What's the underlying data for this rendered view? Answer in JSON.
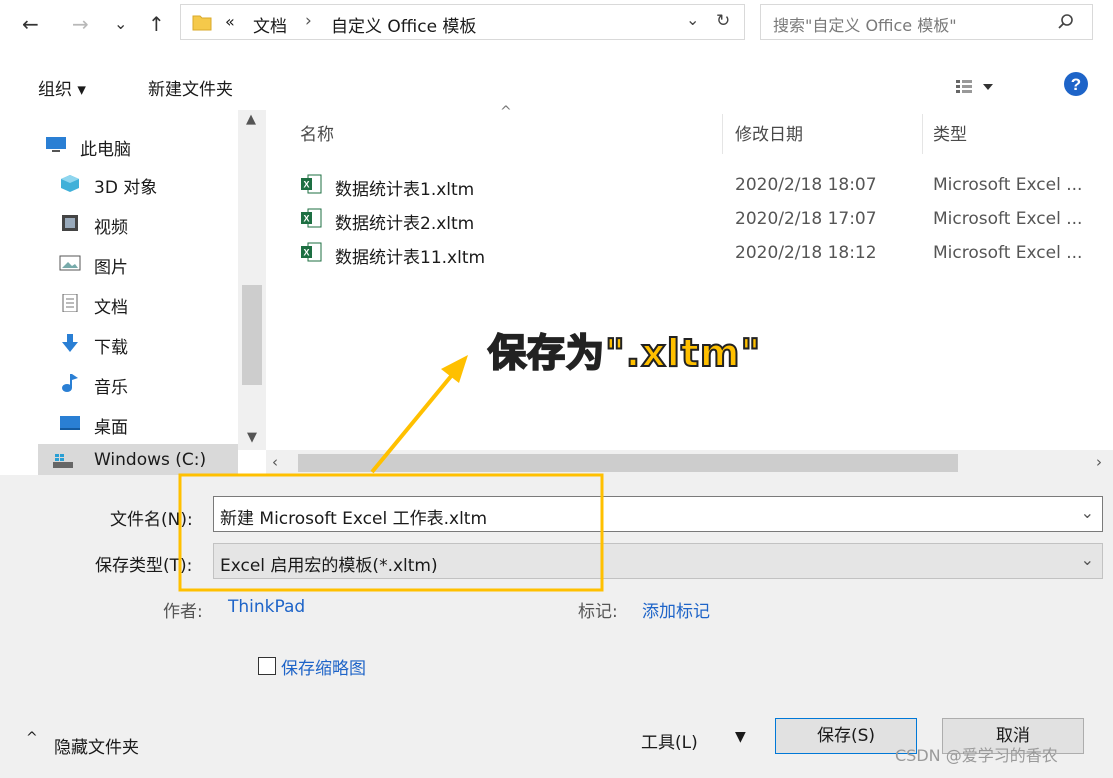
{
  "nav": {
    "back": "←",
    "forward": "→",
    "recent": "⌄",
    "up": "↑"
  },
  "address": {
    "overflow": "«",
    "crumb1": "文档",
    "sep": "›",
    "crumb2": "自定义 Office 模板",
    "dropdown": "⌄",
    "refresh": "↻"
  },
  "search": {
    "placeholder": "搜索\"自定义 Office 模板\""
  },
  "toolbar": {
    "organize": "组织 ▾",
    "new_folder": "新建文件夹"
  },
  "sidebar": {
    "items": [
      {
        "label": "此电脑",
        "icon": "computer-icon"
      },
      {
        "label": "3D 对象",
        "icon": "cube-icon"
      },
      {
        "label": "视频",
        "icon": "video-icon"
      },
      {
        "label": "图片",
        "icon": "picture-icon"
      },
      {
        "label": "文档",
        "icon": "document-icon"
      },
      {
        "label": "下载",
        "icon": "download-icon"
      },
      {
        "label": "音乐",
        "icon": "music-icon"
      },
      {
        "label": "桌面",
        "icon": "desktop-icon"
      },
      {
        "label": "Windows (C:)",
        "icon": "drive-icon"
      }
    ]
  },
  "columns": {
    "name": "名称",
    "date": "修改日期",
    "type": "类型"
  },
  "files": [
    {
      "name": "数据统计表1.xltm",
      "date": "2020/2/18 18:07",
      "type": "Microsoft Excel ..."
    },
    {
      "name": "数据统计表2.xltm",
      "date": "2020/2/18 17:07",
      "type": "Microsoft Excel ..."
    },
    {
      "name": "数据统计表11.xltm",
      "date": "2020/2/18 18:12",
      "type": "Microsoft Excel ..."
    }
  ],
  "annotation": {
    "text": "保存为\".xltm\"",
    "color": "#ffc000"
  },
  "form": {
    "filename_label": "文件名(N):",
    "filename_value": "新建 Microsoft Excel 工作表.xltm",
    "filetype_label": "保存类型(T):",
    "filetype_value": "Excel 启用宏的模板(*.xltm)",
    "author_label": "作者:",
    "author_value": "ThinkPad",
    "tags_label": "标记:",
    "tags_value": "添加标记",
    "thumbnail_label": "保存缩略图"
  },
  "footer": {
    "hide_folders": "隐藏文件夹",
    "tools": "工具(L)",
    "save": "保存(S)",
    "cancel": "取消",
    "watermark": "CSDN @爱学习的香农"
  }
}
